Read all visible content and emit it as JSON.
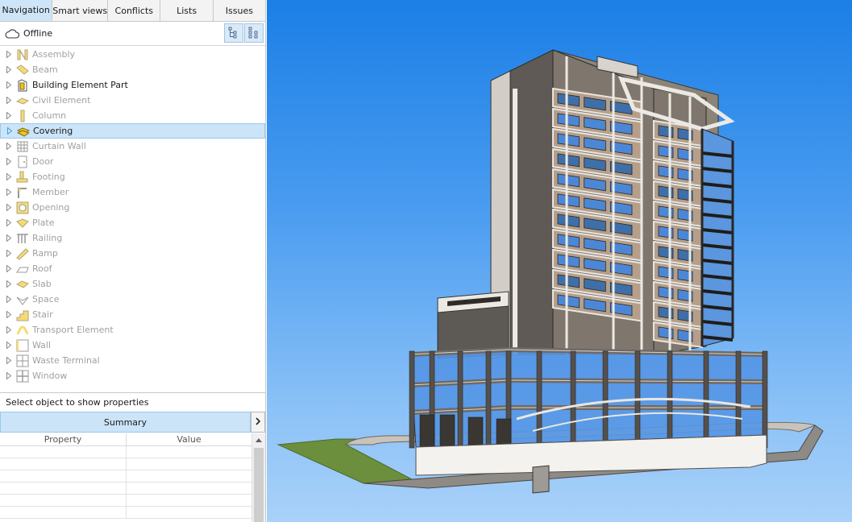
{
  "tabs": [
    {
      "label": "Navigation",
      "active": true
    },
    {
      "label": "Smart views",
      "active": false
    },
    {
      "label": "Conflicts",
      "active": false
    },
    {
      "label": "Lists",
      "active": false
    },
    {
      "label": "Issues",
      "active": false
    }
  ],
  "status": {
    "label": "Offline",
    "icon": "cloud-icon"
  },
  "view_buttons": [
    {
      "icon": "hierarchy-view-icon"
    },
    {
      "icon": "grid-view-icon"
    }
  ],
  "tree": [
    {
      "label": "Assembly",
      "enabled": false,
      "icon": "assembly-icon"
    },
    {
      "label": "Beam",
      "enabled": false,
      "icon": "beam-icon"
    },
    {
      "label": "Building Element Part",
      "enabled": true,
      "icon": "building-element-part-icon"
    },
    {
      "label": "Civil Element",
      "enabled": false,
      "icon": "civil-element-icon"
    },
    {
      "label": "Column",
      "enabled": false,
      "icon": "column-icon"
    },
    {
      "label": "Covering",
      "enabled": true,
      "selected": true,
      "icon": "covering-icon"
    },
    {
      "label": "Curtain Wall",
      "enabled": false,
      "icon": "curtain-wall-icon"
    },
    {
      "label": "Door",
      "enabled": false,
      "icon": "door-icon"
    },
    {
      "label": "Footing",
      "enabled": false,
      "icon": "footing-icon"
    },
    {
      "label": "Member",
      "enabled": false,
      "icon": "member-icon"
    },
    {
      "label": "Opening",
      "enabled": false,
      "icon": "opening-icon"
    },
    {
      "label": "Plate",
      "enabled": false,
      "icon": "plate-icon"
    },
    {
      "label": "Railing",
      "enabled": false,
      "icon": "railing-icon"
    },
    {
      "label": "Ramp",
      "enabled": false,
      "icon": "ramp-icon"
    },
    {
      "label": "Roof",
      "enabled": false,
      "icon": "roof-icon"
    },
    {
      "label": "Slab",
      "enabled": false,
      "icon": "slab-icon"
    },
    {
      "label": "Space",
      "enabled": false,
      "icon": "space-icon"
    },
    {
      "label": "Stair",
      "enabled": false,
      "icon": "stair-icon"
    },
    {
      "label": "Transport Element",
      "enabled": false,
      "icon": "transport-element-icon"
    },
    {
      "label": "Wall",
      "enabled": false,
      "icon": "wall-icon"
    },
    {
      "label": "Waste Terminal",
      "enabled": false,
      "icon": "waste-terminal-icon"
    },
    {
      "label": "Window",
      "enabled": false,
      "icon": "window-icon"
    }
  ],
  "properties": {
    "hint": "Select object to show properties",
    "summary_label": "Summary",
    "columns": [
      "Property",
      "Value"
    ]
  },
  "colors": {
    "selection": "#cce4f7",
    "accent_border": "#99c9ef",
    "sky_top": "#1b7fe6",
    "sky_bottom": "#a9d1f9",
    "icon_yellow": "#f0c419"
  }
}
